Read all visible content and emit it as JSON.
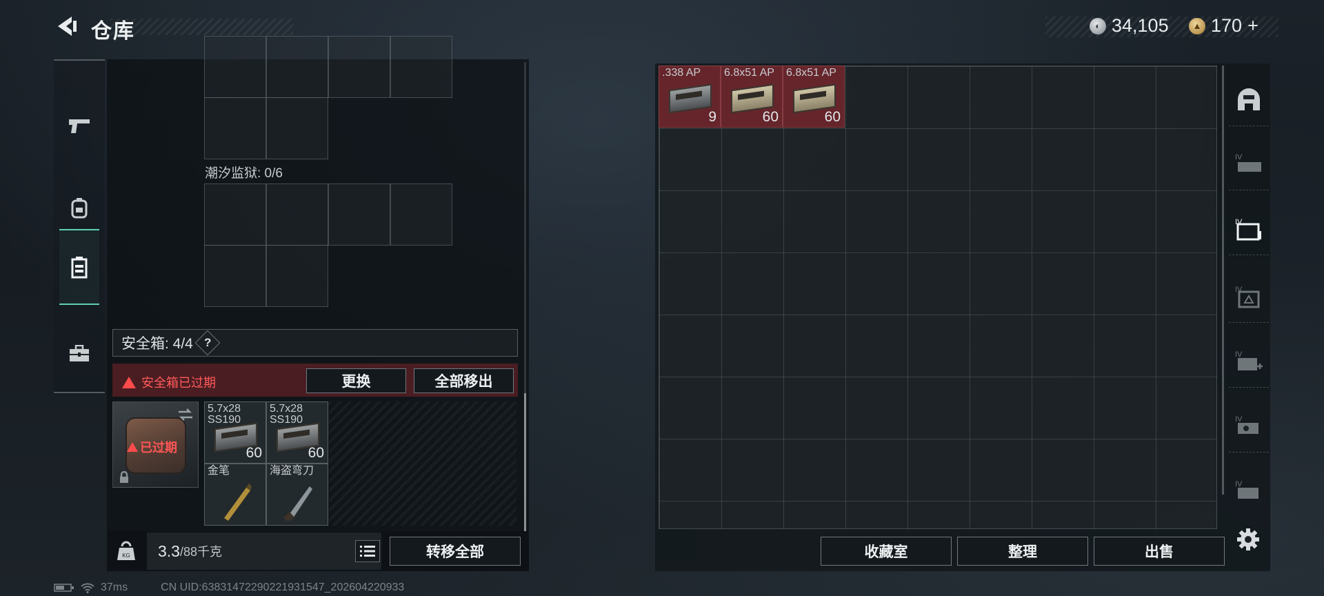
{
  "header": {
    "title": "仓库"
  },
  "currencies": [
    {
      "icon": "silver-coin-icon",
      "value": "34,105"
    },
    {
      "icon": "gold-coin-icon",
      "value": "170",
      "add_label": "+"
    }
  ],
  "left_nav": [
    "gun-icon",
    "backpack-icon",
    "vest-icon",
    "briefcase-icon"
  ],
  "container": {
    "label": "潮汐监狱: 0/6"
  },
  "safe_box": {
    "label": "安全箱: 4/4",
    "help": "?",
    "expired_warning": "安全箱已过期",
    "replace_label": "更换",
    "remove_all_label": "全部移出",
    "expired_badge": "已过期",
    "items": [
      {
        "name": "5.7x28 SS190",
        "qty": "60"
      },
      {
        "name": "5.7x28 SS190",
        "qty": "60"
      },
      {
        "name": "金笔",
        "qty": ""
      },
      {
        "name": "海盗弯刀",
        "qty": ""
      }
    ]
  },
  "weight": {
    "current": "3.3",
    "max": "/88千克"
  },
  "transfer_all_label": "转移全部",
  "stash_items": [
    {
      "name": ".338 AP",
      "qty": "9"
    },
    {
      "name": "6.8x51 AP",
      "qty": "60"
    },
    {
      "name": "6.8x51 AP",
      "qty": "60"
    }
  ],
  "right_tabs": [
    "helmet-icon",
    "tier4-rig-icon",
    "tier4-folder-icon",
    "tier4-bag-icon",
    "tier4-medkit-icon",
    "tier4-tools-icon",
    "tier4-device-icon"
  ],
  "bottom_buttons": {
    "collection": "收藏室",
    "organize": "整理",
    "sell": "出售"
  },
  "status": {
    "ping": "37ms",
    "uid": "CN UID:6383147229022193154​7_202604220933"
  },
  "colors": {
    "accent": "#5fd1b6",
    "warning": "#ff5050",
    "item_highlight": "#6e262c"
  }
}
